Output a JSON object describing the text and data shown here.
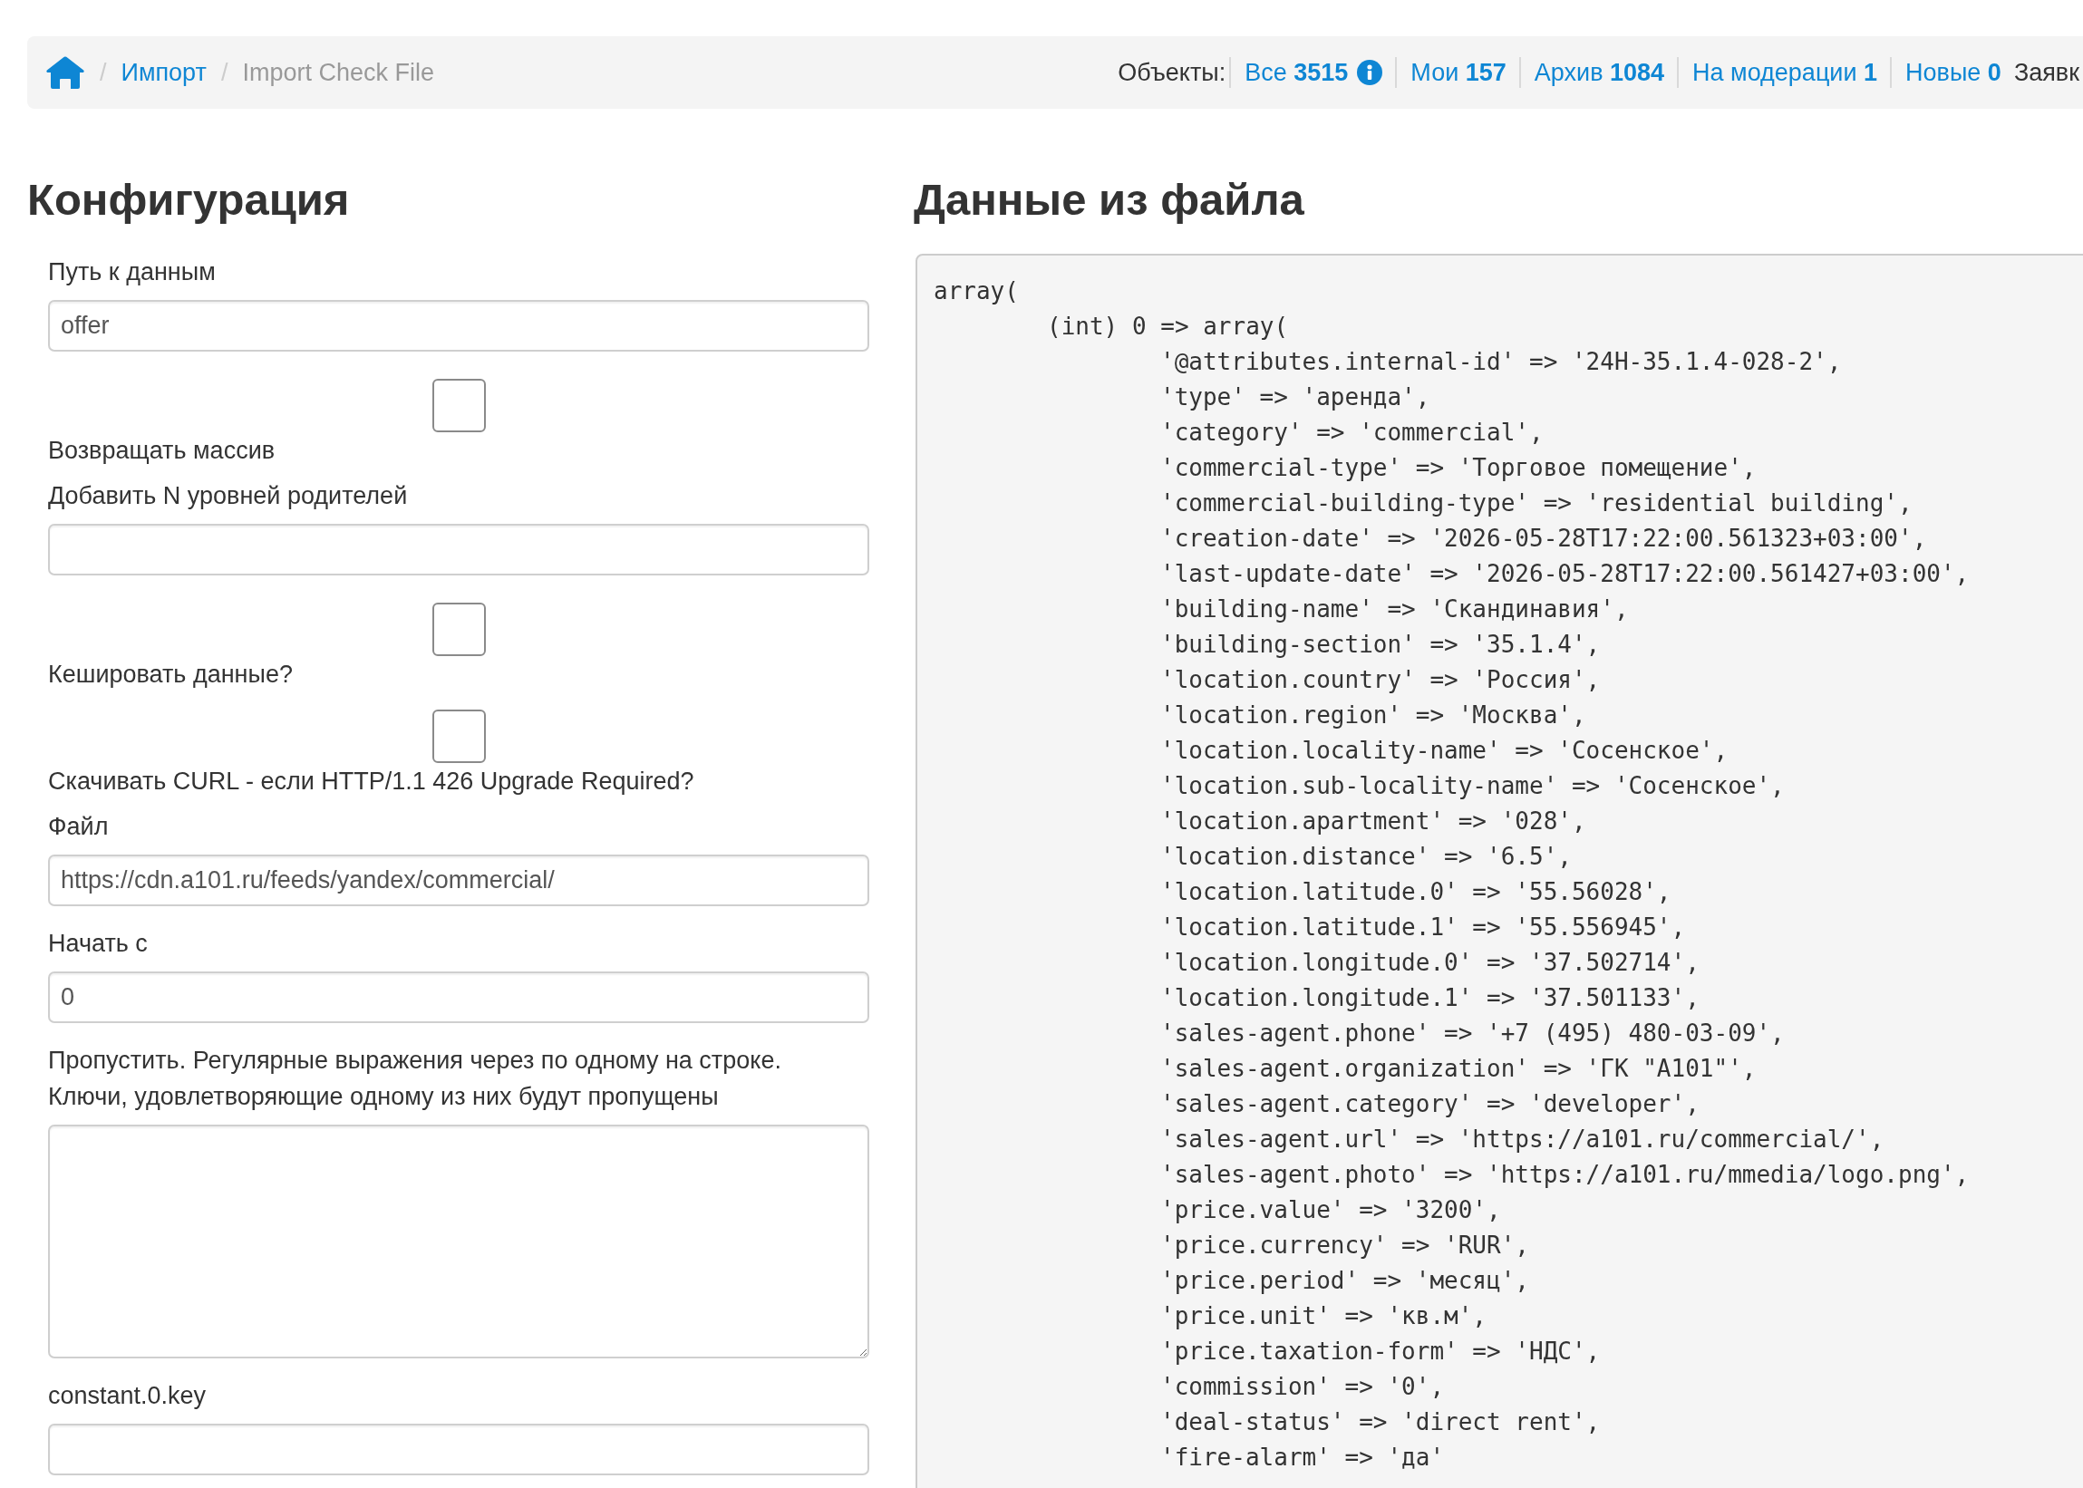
{
  "breadcrumb": [
    {
      "kind": "home"
    },
    {
      "kind": "separator",
      "text": "/"
    },
    {
      "kind": "link",
      "label": "Импорт"
    },
    {
      "kind": "separator",
      "text": "/"
    },
    {
      "kind": "current",
      "label": "Import Check File"
    }
  ],
  "counters": [
    {
      "label": "Объекты:",
      "filters": [
        {
          "label": "Все",
          "count": "3515",
          "info": true
        },
        {
          "label": "Мои",
          "count": "157",
          "info": false
        },
        {
          "label": "Архив",
          "count": "1084",
          "info": false
        },
        {
          "label": "На модерации",
          "count": "1",
          "info": false
        },
        {
          "label": "Новые",
          "count": "0",
          "info": false
        }
      ]
    },
    {
      "label": "Заявк"
    }
  ],
  "config": {
    "title": "Конфигурация",
    "fields": [
      {
        "kind": "text",
        "label": "Путь к данным",
        "value": "offer"
      },
      {
        "kind": "checkbox",
        "label": "Возвращать массив",
        "checked": false
      },
      {
        "kind": "text",
        "label": "Добавить N уровней родителей"
      },
      {
        "kind": "checkbox",
        "label": "Кешировать данные?",
        "checked": false
      },
      {
        "kind": "checkbox",
        "label": "Скачивать CURL - если HTTP/1.1 426 Upgrade Required?",
        "checked": false
      },
      {
        "kind": "text",
        "label": "Файл",
        "value": "https://cdn.a101.ru/feeds/yandex/commercial/"
      },
      {
        "kind": "text",
        "label": "Начать с",
        "value": "0"
      },
      {
        "kind": "textarea",
        "label": "Пропустить. Регулярные выражения через по одному на строке. Ключи, удовлетворяющие одному из них будут пропущены"
      },
      {
        "kind": "text",
        "label": "constant.0.key"
      }
    ]
  },
  "data_panel": {
    "title": "Данные из файла",
    "dump": [
      {
        "line": "array(",
        "children": [
          {
            "line": "(int) 0 => array(",
            "children": [
              {
                "line": "'@attributes.internal-id' => '24H-35.1.4-028-2',"
              },
              {
                "line": "'type' => 'аренда',"
              },
              {
                "line": "'category' => 'commercial',"
              },
              {
                "line": "'commercial-type' => 'Торговое помещение',"
              },
              {
                "line": "'commercial-building-type' => 'residential building',"
              },
              {
                "line": "'creation-date' => '2026-05-28T17:22:00.561323+03:00',"
              },
              {
                "line": "'last-update-date' => '2026-05-28T17:22:00.561427+03:00',"
              },
              {
                "line": "'building-name' => 'Скандинавия',"
              },
              {
                "line": "'building-section' => '35.1.4',"
              },
              {
                "line": "'location.country' => 'Россия',"
              },
              {
                "line": "'location.region' => 'Москва',"
              },
              {
                "line": "'location.locality-name' => 'Сосенское',"
              },
              {
                "line": "'location.sub-locality-name' => 'Сосенское',"
              },
              {
                "line": "'location.apartment' => '028',"
              },
              {
                "line": "'location.distance' => '6.5',"
              },
              {
                "line": "'location.latitude.0' => '55.56028',"
              },
              {
                "line": "'location.latitude.1' => '55.556945',"
              },
              {
                "line": "'location.longitude.0' => '37.502714',"
              },
              {
                "line": "'location.longitude.1' => '37.501133',"
              },
              {
                "line": "'sales-agent.phone' => '+7 (495) 480-03-09',"
              },
              {
                "line": "'sales-agent.organization' => 'ГК \"А101\"',"
              },
              {
                "line": "'sales-agent.category' => 'developer',"
              },
              {
                "line": "'sales-agent.url' => 'https://a101.ru/commercial/',"
              },
              {
                "line": "'sales-agent.photo' => 'https://a101.ru/mmedia/logo.png',"
              },
              {
                "line": "'price.value' => '3200',"
              },
              {
                "line": "'price.currency' => 'RUR',"
              },
              {
                "line": "'price.period' => 'месяц',"
              },
              {
                "line": "'price.unit' => 'кв.м',"
              },
              {
                "line": "'price.taxation-form' => 'НДС',"
              },
              {
                "line": "'commission' => '0',"
              },
              {
                "line": "'deal-status' => 'direct rent',"
              },
              {
                "line": "'fire-alarm' => 'да'"
              }
            ]
          }
        ]
      }
    ]
  }
}
